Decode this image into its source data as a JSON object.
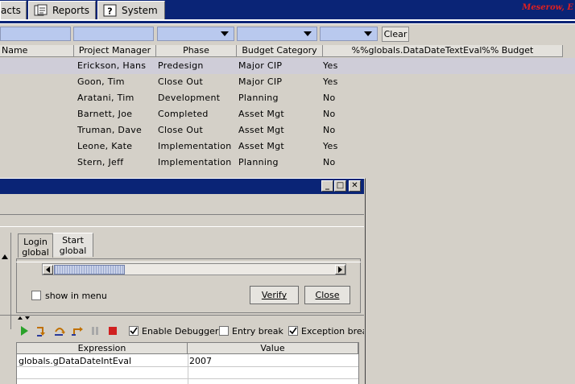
{
  "top_tabs": [
    {
      "label": "acts",
      "icon": null
    },
    {
      "label": "Reports",
      "icon": "reports-icon"
    },
    {
      "label": "System",
      "icon": "help-icon"
    }
  ],
  "brand": "Meserow, E",
  "filter_bar": {
    "clear_label": "Clear"
  },
  "grid": {
    "columns": [
      "Name",
      "Project Manager",
      "Phase",
      "Budget Category",
      "%%globals.DataDateTextEval%% Budget"
    ],
    "rows": [
      {
        "manager": "Erickson, Hans",
        "phase": "Predesign",
        "category": "Major CIP",
        "budget": "Yes"
      },
      {
        "manager": "Goon, Tim",
        "phase": "Close Out",
        "category": "Major CIP",
        "budget": "Yes"
      },
      {
        "manager": "Aratani, Tim",
        "phase": "Development",
        "category": "Planning",
        "budget": "No"
      },
      {
        "manager": "Barnett, Joe",
        "phase": "Completed",
        "category": "Asset Mgt",
        "budget": "No"
      },
      {
        "manager": "Truman, Dave",
        "phase": "Close Out",
        "category": "Asset Mgt",
        "budget": "No"
      },
      {
        "manager": "Leone, Kate",
        "phase": "Implementation",
        "category": "Asset Mgt",
        "budget": "Yes"
      },
      {
        "manager": "Stern, Jeff",
        "phase": "Implementation",
        "category": "Planning",
        "budget": "No"
      }
    ]
  },
  "dialog": {
    "title_buttons": [
      "_",
      "□",
      "✕"
    ],
    "tabs": [
      {
        "line1": "Login",
        "line2": "global"
      },
      {
        "line1": "Start",
        "line2": "global"
      }
    ],
    "show_in_menu_label": "show in menu",
    "verify_label": "Verify",
    "close_label": "Close",
    "debug_toolbar": {
      "enable_debugger_label": "Enable Debugger",
      "entry_break_label": "Entry break",
      "exception_break_label": "Exception break",
      "enable_debugger_checked": true,
      "entry_break_checked": false,
      "exception_break_checked": true
    },
    "expression_table": {
      "headers": [
        "Expression",
        "Value"
      ],
      "rows": [
        {
          "expression": "globals.gDataDateIntEval",
          "value": "2007"
        }
      ]
    }
  }
}
